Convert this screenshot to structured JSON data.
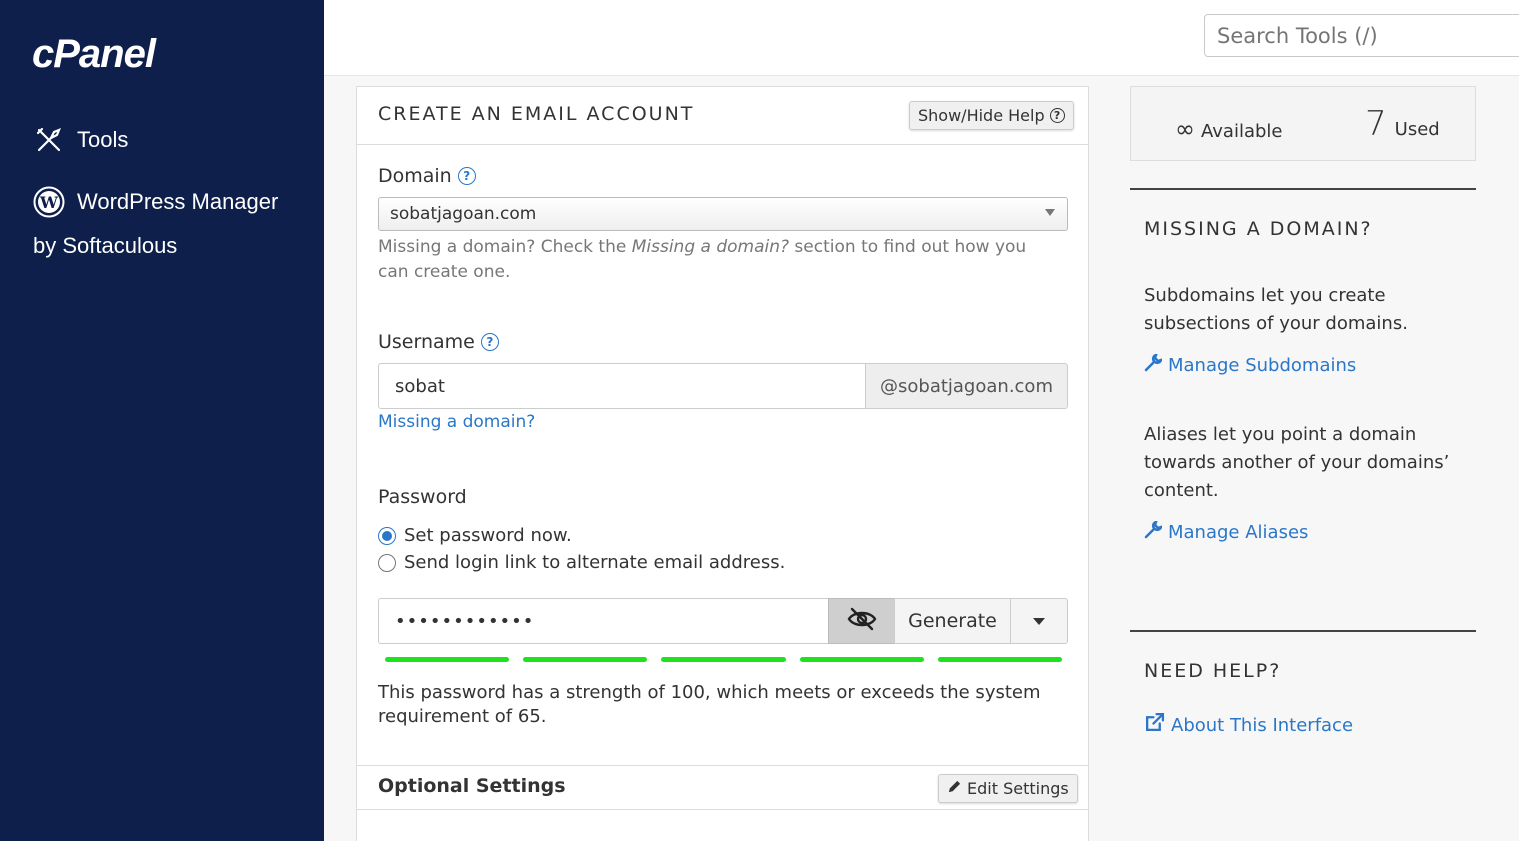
{
  "sidebar": {
    "logo": "cPanel",
    "items": [
      {
        "label": "Tools",
        "icon": "tools-icon"
      },
      {
        "label": "WordPress Manager",
        "sub": "by Softaculous",
        "icon": "wordpress-icon"
      }
    ]
  },
  "search": {
    "placeholder": "Search Tools (/)"
  },
  "form": {
    "title": "CREATE AN EMAIL ACCOUNT",
    "help_button": "Show/Hide Help",
    "domain_label": "Domain",
    "domain_value": "sobatjagoan.com",
    "domain_help_1": "Missing a domain? Check the ",
    "domain_help_em": "Missing a domain?",
    "domain_help_2": " section to find out how you can create one.",
    "username_label": "Username",
    "username_value": "sobat",
    "username_suffix": "@sobatjagoan.com",
    "missing_link": "Missing a domain?",
    "password_label": "Password",
    "radio_set_now": "Set password now.",
    "radio_send_link": "Send login link to alternate email address.",
    "password_value": "••••••••••••",
    "generate_label": "Generate",
    "strength_segments": 5,
    "strength_text": "This password has a strength of 100, which meets or exceeds the system requirement of 65.",
    "optional_title": "Optional Settings",
    "edit_settings": "Edit Settings"
  },
  "stats": {
    "available_symbol": "∞",
    "available_label": "Available",
    "used_value": "7",
    "used_label": "Used"
  },
  "missing_domain": {
    "title": "MISSING A DOMAIN?",
    "subdomains_text": "Subdomains let you create subsections of your domains.",
    "subdomains_link": "Manage Subdomains",
    "aliases_text": "Aliases let you point a domain towards another of your domains’ content.",
    "aliases_link": "Manage Aliases"
  },
  "need_help": {
    "title": "NEED HELP?",
    "link": "About This Interface"
  },
  "colors": {
    "sidebar_bg": "#0d1f4a",
    "link": "#2a77c9",
    "strength": "#1ee21e"
  }
}
